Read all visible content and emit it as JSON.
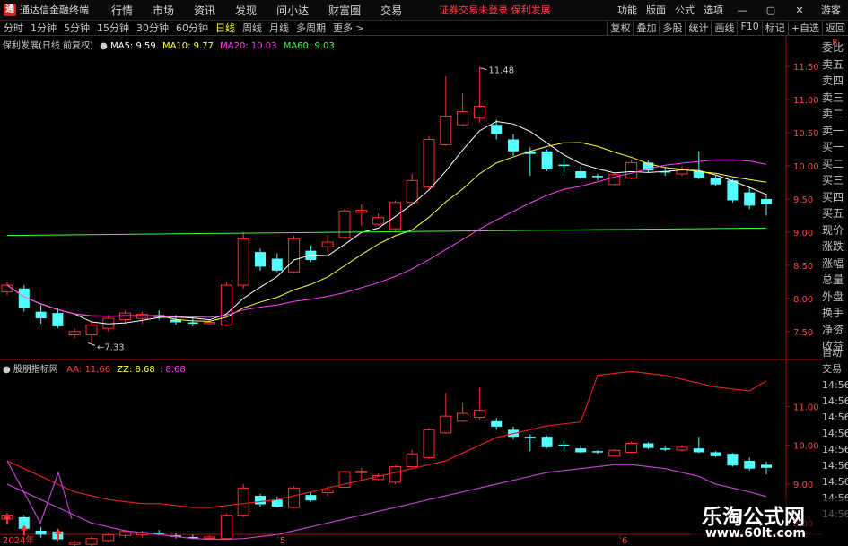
{
  "titlebar": {
    "app_title": "通达信金融终端",
    "logo_glyph": "通",
    "menu": [
      "行情",
      "市场",
      "资讯",
      "发现",
      "问小达",
      "财富圈",
      "交易"
    ],
    "notice": "证券交易未登录  保利发展",
    "right_menu": [
      "功能",
      "版面",
      "公式",
      "选项"
    ],
    "guest": "游客",
    "window_icons": [
      "minimize-icon",
      "restore-icon",
      "close-icon"
    ]
  },
  "toolbar": {
    "periods": [
      "分时",
      "1分钟",
      "5分钟",
      "15分钟",
      "30分钟",
      "60分钟",
      "日线",
      "周线",
      "月线",
      "多周期",
      "更多 >"
    ],
    "active_period": "日线",
    "tools": [
      "复权",
      "叠加",
      "多股",
      "统计",
      "画线",
      "F10",
      "标记",
      "+自选",
      "返回"
    ]
  },
  "main_chart": {
    "stock": "保利发展(日线 前复权)",
    "ma": [
      {
        "label": "MA5: 9.59",
        "color": "#ffffff"
      },
      {
        "label": "MA10: 9.77",
        "color": "#ffff40"
      },
      {
        "label": "MA20: 10.03",
        "color": "#ff40ff"
      },
      {
        "label": "MA60: 9.03",
        "color": "#40ff40"
      }
    ],
    "high_label": "11.48",
    "low_label": "7.33",
    "price_ticks": [
      "11.50",
      "11.00",
      "10.50",
      "10.00",
      "9.50",
      "9.00",
      "8.50",
      "8.00",
      "7.50"
    ]
  },
  "indicator": {
    "name": "股朋指标网",
    "aa_label": "AA: 11.66",
    "zz_label": "ZZ: 8.68",
    "third_label": ": 8.68",
    "ticks": [
      "11.00",
      "10.00",
      "9.00",
      "8.00"
    ]
  },
  "x_axis": {
    "labels": [
      "2024年",
      "5",
      "6"
    ]
  },
  "side_panel": {
    "items": [
      "委比",
      "卖五",
      "卖四",
      "卖三",
      "卖二",
      "卖一",
      "买一",
      "买二",
      "买三",
      "买四",
      "买五",
      "现价",
      "涨跌",
      "涨幅",
      "总量",
      "外盘",
      "换手",
      "净资",
      "收益"
    ],
    "items2": [
      "自动",
      "交易",
      "14:56",
      "14:56",
      "14:56",
      "14:56",
      "14:56",
      "14:56",
      "14:56",
      "14:56",
      "14:56"
    ]
  },
  "watermark": {
    "line1": "乐淘公式网",
    "line2": "www.60lt.com"
  },
  "chart_data": {
    "type": "candlestick",
    "series": [
      {
        "o": 8.1,
        "h": 8.25,
        "c": 8.2,
        "l": 8.05
      },
      {
        "o": 8.15,
        "h": 8.2,
        "c": 7.85,
        "l": 7.8
      },
      {
        "o": 7.8,
        "h": 7.9,
        "c": 7.7,
        "l": 7.62
      },
      {
        "o": 7.78,
        "h": 7.85,
        "c": 7.58,
        "l": 7.55
      },
      {
        "o": 7.45,
        "h": 7.55,
        "c": 7.5,
        "l": 7.4
      },
      {
        "o": 7.45,
        "h": 7.65,
        "c": 7.6,
        "l": 7.33
      },
      {
        "o": 7.55,
        "h": 7.75,
        "c": 7.7,
        "l": 7.5
      },
      {
        "o": 7.68,
        "h": 7.82,
        "c": 7.78,
        "l": 7.62
      },
      {
        "o": 7.7,
        "h": 7.8,
        "c": 7.76,
        "l": 7.62
      },
      {
        "o": 7.75,
        "h": 7.82,
        "c": 7.72,
        "l": 7.68
      },
      {
        "o": 7.68,
        "h": 7.75,
        "c": 7.64,
        "l": 7.6
      },
      {
        "o": 7.64,
        "h": 7.7,
        "c": 7.63,
        "l": 7.58
      },
      {
        "o": 7.62,
        "h": 7.68,
        "c": 7.64,
        "l": 7.6
      },
      {
        "o": 7.6,
        "h": 8.25,
        "c": 8.2,
        "l": 7.58
      },
      {
        "o": 8.2,
        "h": 9.0,
        "c": 8.9,
        "l": 8.15
      },
      {
        "o": 8.7,
        "h": 8.75,
        "c": 8.48,
        "l": 8.42
      },
      {
        "o": 8.6,
        "h": 8.68,
        "c": 8.42,
        "l": 8.4
      },
      {
        "o": 8.4,
        "h": 8.95,
        "c": 8.9,
        "l": 8.38
      },
      {
        "o": 8.72,
        "h": 8.8,
        "c": 8.58,
        "l": 8.55
      },
      {
        "o": 8.78,
        "h": 8.95,
        "c": 8.85,
        "l": 8.7
      },
      {
        "o": 8.92,
        "h": 9.35,
        "c": 9.32,
        "l": 8.9
      },
      {
        "o": 9.3,
        "h": 9.42,
        "c": 9.33,
        "l": 9.1
      },
      {
        "o": 9.12,
        "h": 9.28,
        "c": 9.22,
        "l": 9.1
      },
      {
        "o": 9.05,
        "h": 9.48,
        "c": 9.45,
        "l": 9.0
      },
      {
        "o": 9.45,
        "h": 9.88,
        "c": 9.78,
        "l": 9.4
      },
      {
        "o": 9.68,
        "h": 10.45,
        "c": 10.4,
        "l": 9.65
      },
      {
        "o": 10.32,
        "h": 11.35,
        "c": 10.75,
        "l": 10.3
      },
      {
        "o": 10.62,
        "h": 11.1,
        "c": 10.82,
        "l": 10.6
      },
      {
        "o": 10.72,
        "h": 11.48,
        "c": 10.9,
        "l": 10.65
      },
      {
        "o": 10.62,
        "h": 10.7,
        "c": 10.48,
        "l": 10.4
      },
      {
        "o": 10.4,
        "h": 10.48,
        "c": 10.22,
        "l": 10.15
      },
      {
        "o": 10.22,
        "h": 10.28,
        "c": 10.18,
        "l": 9.85
      },
      {
        "o": 10.22,
        "h": 10.25,
        "c": 9.95,
        "l": 9.92
      },
      {
        "o": 10.02,
        "h": 10.12,
        "c": 10.0,
        "l": 9.85
      },
      {
        "o": 9.92,
        "h": 10.0,
        "c": 9.82,
        "l": 9.8
      },
      {
        "o": 9.85,
        "h": 9.88,
        "c": 9.83,
        "l": 9.78
      },
      {
        "o": 9.72,
        "h": 9.9,
        "c": 9.87,
        "l": 9.7
      },
      {
        "o": 9.82,
        "h": 10.1,
        "c": 10.05,
        "l": 9.8
      },
      {
        "o": 10.05,
        "h": 10.08,
        "c": 9.93,
        "l": 9.9
      },
      {
        "o": 9.92,
        "h": 9.98,
        "c": 9.9,
        "l": 9.85
      },
      {
        "o": 9.88,
        "h": 10.0,
        "c": 9.95,
        "l": 9.85
      },
      {
        "o": 9.92,
        "h": 10.22,
        "c": 9.82,
        "l": 9.8
      },
      {
        "o": 9.82,
        "h": 9.85,
        "c": 9.72,
        "l": 9.7
      },
      {
        "o": 9.78,
        "h": 9.8,
        "c": 9.48,
        "l": 9.45
      },
      {
        "o": 9.6,
        "h": 9.68,
        "c": 9.4,
        "l": 9.35
      },
      {
        "o": 9.5,
        "h": 9.58,
        "c": 9.42,
        "l": 9.25
      }
    ],
    "price_range": [
      7.2,
      11.8
    ],
    "aa_line": [
      9.6,
      9.4,
      9.2,
      9.0,
      8.8,
      8.7,
      8.6,
      8.55,
      8.5,
      8.5,
      8.45,
      8.4,
      8.4,
      8.45,
      8.5,
      8.55,
      8.6,
      8.7,
      8.8,
      8.9,
      9.0,
      9.1,
      9.2,
      9.3,
      9.4,
      9.5,
      9.6,
      9.8,
      10.0,
      10.2,
      10.3,
      10.4,
      10.5,
      10.55,
      10.6,
      11.8,
      11.85,
      11.9,
      11.85,
      11.8,
      11.7,
      11.6,
      11.5,
      11.45,
      11.4,
      11.66
    ],
    "zz_line": [
      9.0,
      8.8,
      8.6,
      8.4,
      8.2,
      8.0,
      7.9,
      7.8,
      7.75,
      7.7,
      7.65,
      7.6,
      7.58,
      7.58,
      7.6,
      7.65,
      7.7,
      7.8,
      7.9,
      8.0,
      8.1,
      8.2,
      8.3,
      8.4,
      8.5,
      8.6,
      8.7,
      8.8,
      8.9,
      9.0,
      9.1,
      9.2,
      9.3,
      9.35,
      9.4,
      9.45,
      9.5,
      9.5,
      9.45,
      9.4,
      9.3,
      9.2,
      9.0,
      8.9,
      8.8,
      8.68
    ],
    "ind_range": [
      7.8,
      12.0
    ]
  }
}
